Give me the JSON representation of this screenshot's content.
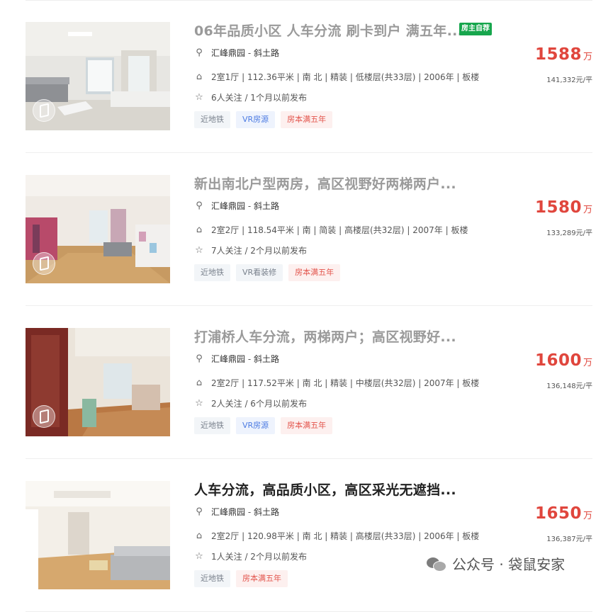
{
  "listings": [
    {
      "title": "06年品质小区 人车分流 刷卡到户 满五年...",
      "owner_tag": "房主自荐",
      "community": "汇峰鼎园",
      "street": "斜土路",
      "details": "2室1厅 | 112.36平米 | 南 北 | 精装 | 低楼层(共33层) | 2006年 | 板楼",
      "followers": "6人关注 / 1个月以前发布",
      "tags": [
        {
          "label": "近地铁",
          "style": "gray"
        },
        {
          "label": "VR房源",
          "style": "blue"
        },
        {
          "label": "房本满五年",
          "style": "red"
        }
      ],
      "price": "1588",
      "price_unit": "万",
      "unit_price": "141,332元/平"
    },
    {
      "title": "新出南北户型两房，高区视野好两梯两户...",
      "owner_tag": "",
      "community": "汇峰鼎园",
      "street": "斜土路",
      "details": "2室2厅 | 118.54平米 | 南 | 简装 | 高楼层(共32层) | 2007年 | 板楼",
      "followers": "7人关注 / 2个月以前发布",
      "tags": [
        {
          "label": "近地铁",
          "style": "gray"
        },
        {
          "label": "VR看装修",
          "style": "gray"
        },
        {
          "label": "房本满五年",
          "style": "red"
        }
      ],
      "price": "1580",
      "price_unit": "万",
      "unit_price": "133,289元/平"
    },
    {
      "title": "打浦桥人车分流，两梯两户；高区视野好...",
      "owner_tag": "",
      "community": "汇峰鼎园",
      "street": "斜土路",
      "details": "2室2厅 | 117.52平米 | 南 北 | 精装 | 中楼层(共32层) | 2007年 | 板楼",
      "followers": "2人关注 / 6个月以前发布",
      "tags": [
        {
          "label": "近地铁",
          "style": "gray"
        },
        {
          "label": "VR房源",
          "style": "blue"
        },
        {
          "label": "房本满五年",
          "style": "red"
        }
      ],
      "price": "1600",
      "price_unit": "万",
      "unit_price": "136,148元/平"
    },
    {
      "title": "人车分流，高品质小区，高区采光无遮挡...",
      "owner_tag": "",
      "community": "汇峰鼎园",
      "street": "斜土路",
      "details": "2室2厅 | 120.98平米 | 南 北 | 精装 | 高楼层(共33层) | 2006年 | 板楼",
      "followers": "1人关注 / 2个月以前发布",
      "tags": [
        {
          "label": "近地铁",
          "style": "gray"
        },
        {
          "label": "房本满五年",
          "style": "red"
        }
      ],
      "price": "1650",
      "price_unit": "万",
      "unit_price": "136,387元/平"
    }
  ],
  "watermark": {
    "text": "公众号 · 袋鼠安家"
  },
  "colors": {
    "price": "#e0463d",
    "owner_tag": "#17a64d",
    "tag_blue": "#4c7be2",
    "tag_red": "#e3554d"
  },
  "icons": {
    "location": "location-pin-icon",
    "house": "house-icon",
    "follow": "star-icon",
    "vr": "vr-cube-icon"
  }
}
